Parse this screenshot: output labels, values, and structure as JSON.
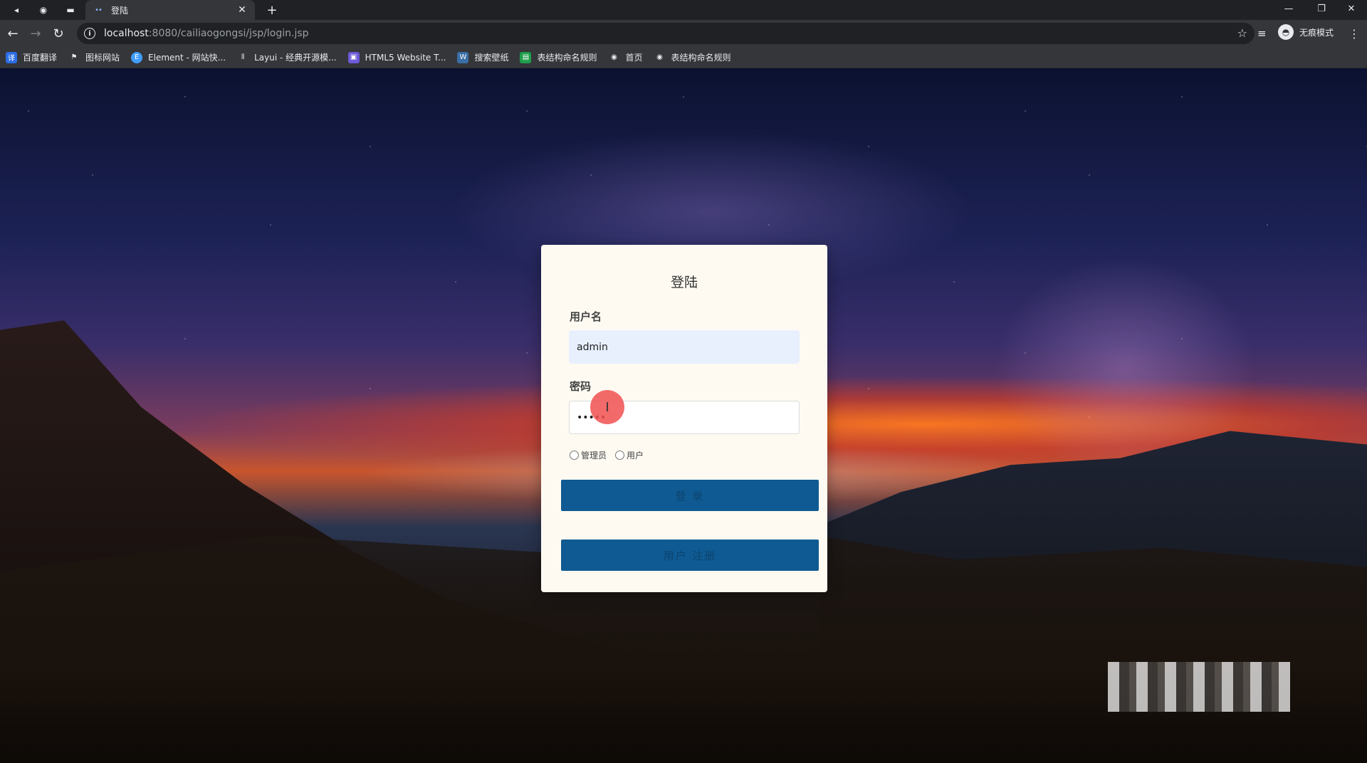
{
  "browser": {
    "tab_title": "登陆",
    "url_host": "localhost",
    "url_rest": ":8080/cailiaogongsi/jsp/login.jsp",
    "profile_label": "无痕模式",
    "bookmarks": [
      {
        "label": "百度翻译",
        "color": "#2b6de5"
      },
      {
        "label": "图标网站",
        "color": "#555555"
      },
      {
        "label": "Element - 网站快...",
        "color": "#409eff"
      },
      {
        "label": "Layui - 经典开源模...",
        "color": "#666666"
      },
      {
        "label": "HTML5 Website T...",
        "color": "#6b5bd6"
      },
      {
        "label": "搜索壁纸",
        "color": "#3a6ea5"
      },
      {
        "label": "表结构命名规则",
        "color": "#1e9e4a"
      },
      {
        "label": "首页",
        "color": "#888888"
      },
      {
        "label": "表结构命名规则",
        "color": "#888888"
      }
    ]
  },
  "login": {
    "title": "登陆",
    "username_label": "用户名",
    "username_value": "admin",
    "password_label": "密码",
    "password_value": "•••••",
    "role_admin": "管理员",
    "role_user": "用户",
    "login_button": "登 录",
    "register_button": "用户 注册"
  }
}
